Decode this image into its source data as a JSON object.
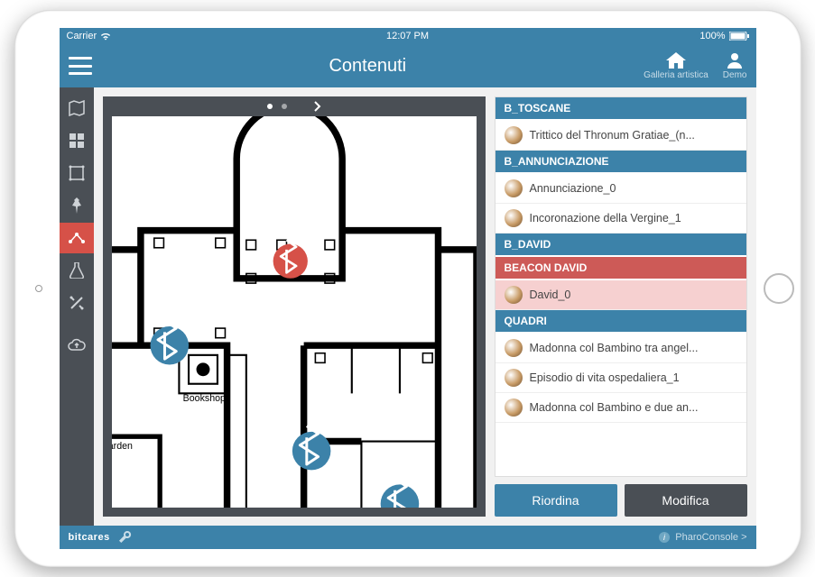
{
  "status": {
    "carrier": "Carrier",
    "time": "12:07 PM",
    "battery": "100%"
  },
  "appbar": {
    "title": "Contenuti",
    "right": [
      {
        "label": "Galleria artistica",
        "icon": "home"
      },
      {
        "label": "Demo",
        "icon": "user"
      }
    ]
  },
  "floorplan": {
    "labels": {
      "bookshop": "Bookshop",
      "garden": "arden"
    }
  },
  "list": [
    {
      "kind": "header",
      "label": "B_TOSCANE"
    },
    {
      "kind": "item",
      "label": "Trittico del Thronum Gratiae_(n..."
    },
    {
      "kind": "header",
      "label": "B_ANNUNCIAZIONE"
    },
    {
      "kind": "item",
      "label": "Annunciazione_0"
    },
    {
      "kind": "item",
      "label": "Incoronazione della Vergine_1"
    },
    {
      "kind": "header",
      "label": "B_DAVID"
    },
    {
      "kind": "header-alert",
      "label": "BEACON DAVID"
    },
    {
      "kind": "item",
      "label": "David_0",
      "selected": true
    },
    {
      "kind": "header",
      "label": "QUADRI"
    },
    {
      "kind": "item",
      "label": "Madonna col Bambino tra angel..."
    },
    {
      "kind": "item",
      "label": "Episodio di vita ospedaliera_1"
    },
    {
      "kind": "item",
      "label": "Madonna col Bambino e due an..."
    }
  ],
  "actions": {
    "reorder": "Riordina",
    "edit": "Modifica"
  },
  "footer": {
    "brand": "bitcares",
    "console": "PharoConsole >"
  }
}
